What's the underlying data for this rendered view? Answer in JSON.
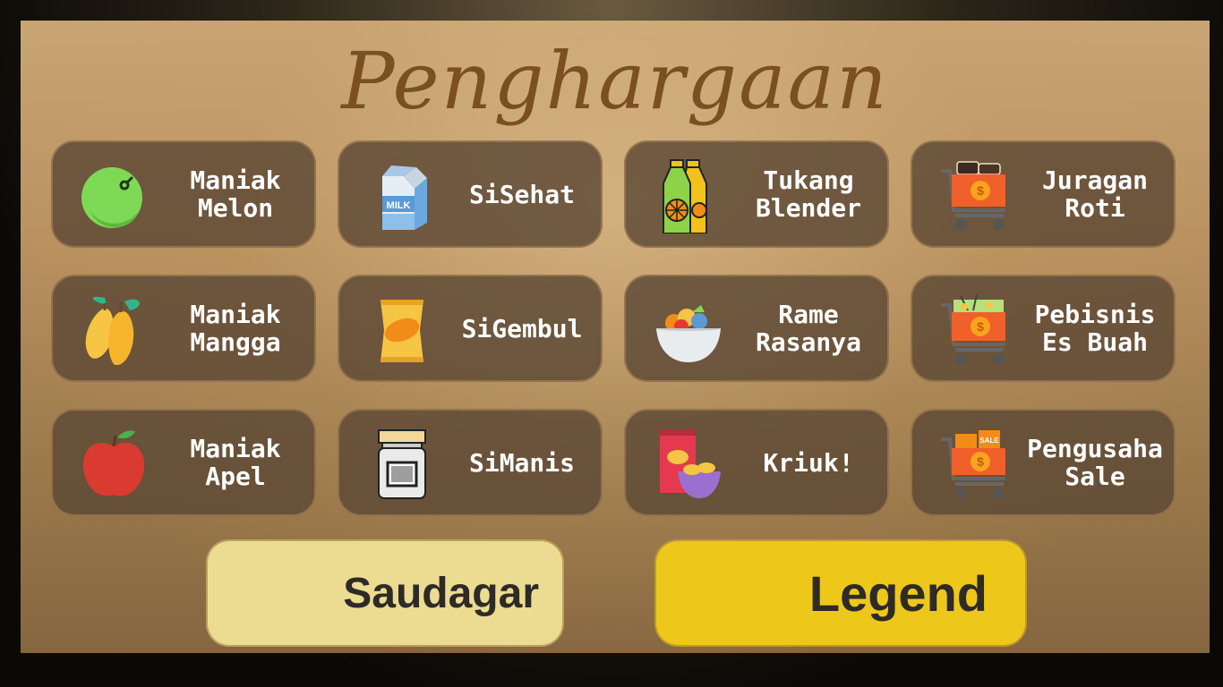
{
  "screen": {
    "title": "Penghargaan"
  },
  "achievements": [
    {
      "label": "Maniak\nMelon",
      "icon": "melon-icon"
    },
    {
      "label": "SiSehat",
      "icon": "milk-carton-icon",
      "icon_text": "MILK"
    },
    {
      "label": "Tukang\nBlender",
      "icon": "juice-bottles-icon"
    },
    {
      "label": "Juragan\nRoti",
      "icon": "cart-bread-icon"
    },
    {
      "label": "Maniak\nMangga",
      "icon": "mango-icon"
    },
    {
      "label": "SiGembul",
      "icon": "snack-bag-icon"
    },
    {
      "label": "Rame\nRasanya",
      "icon": "fruit-bowl-icon"
    },
    {
      "label": "Pebisnis\nEs Buah",
      "icon": "cart-drinks-icon"
    },
    {
      "label": "Maniak\nApel",
      "icon": "apple-icon"
    },
    {
      "label": "SiManis",
      "icon": "jam-jar-icon"
    },
    {
      "label": "Kriuk!",
      "icon": "chips-bowl-icon"
    },
    {
      "label": "Pengusaha\nSale",
      "icon": "cart-sale-icon",
      "icon_text": "SALE"
    }
  ],
  "tiers": {
    "saudagar_label": "Saudagar",
    "legend_label": "Legend"
  },
  "colors": {
    "title": "#7a4f22",
    "card_bg": "#5c4834",
    "saudagar_bg": "#ebdc91",
    "legend_bg": "#edc81a"
  }
}
